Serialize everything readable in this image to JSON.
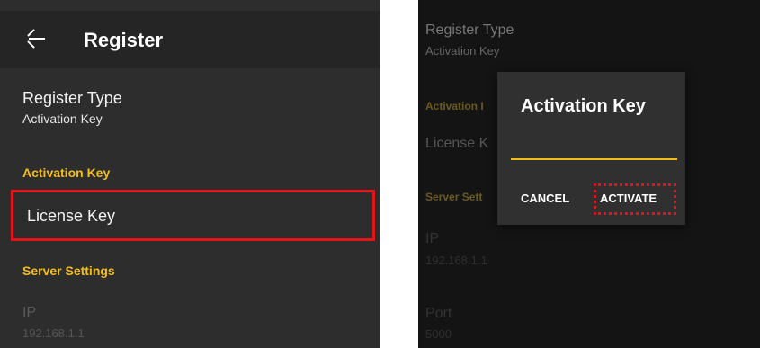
{
  "left_screen": {
    "header": {
      "back_icon": "arrow-left-icon",
      "title": "Register"
    },
    "register_type": {
      "title": "Register Type",
      "value": "Activation Key"
    },
    "activation_section": {
      "header": "Activation Key",
      "license_key_label": "License Key"
    },
    "server_settings": {
      "header": "Server Settings",
      "ip_label": "IP",
      "ip_value": "192.168.1.1"
    }
  },
  "right_screen": {
    "background": {
      "register_type_title": "Register Type",
      "register_type_value": "Activation Key",
      "activation_header_partial": "Activation I",
      "license_key_partial": "License K",
      "server_settings_partial": "Server Sett",
      "ip_label": "IP",
      "ip_value": "192.168.1.1",
      "port_label": "Port",
      "port_value": "5000"
    },
    "dialog": {
      "title": "Activation Key",
      "input_value": "",
      "cancel_label": "CANCEL",
      "activate_label": "ACTIVATE"
    }
  },
  "colors": {
    "accent": "#f4bf1c",
    "highlight": "#e3141a",
    "background": "#2d2d2d"
  }
}
